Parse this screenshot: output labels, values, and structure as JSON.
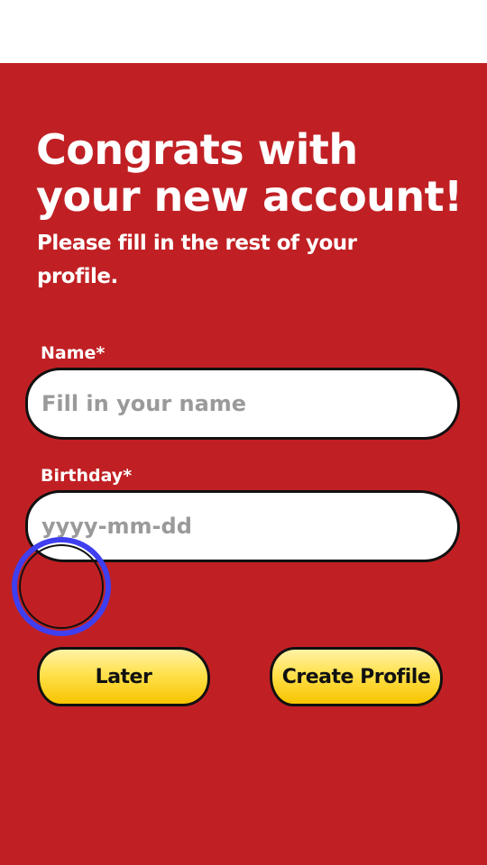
{
  "header": {
    "title": "Congrats with your new account!",
    "subtitle": "Please fill in the rest of your profile."
  },
  "form": {
    "name": {
      "label": "Name*",
      "value": "",
      "placeholder": "Fill in your name"
    },
    "birthday": {
      "label": "Birthday*",
      "value": "",
      "placeholder": "yyyy-mm-dd"
    }
  },
  "actions": {
    "later_label": "Later",
    "create_label": "Create Profile"
  },
  "colors": {
    "background": "#c02024",
    "button_yellow": "#ffe14d",
    "tap_indicator": "#3f3ff0"
  }
}
